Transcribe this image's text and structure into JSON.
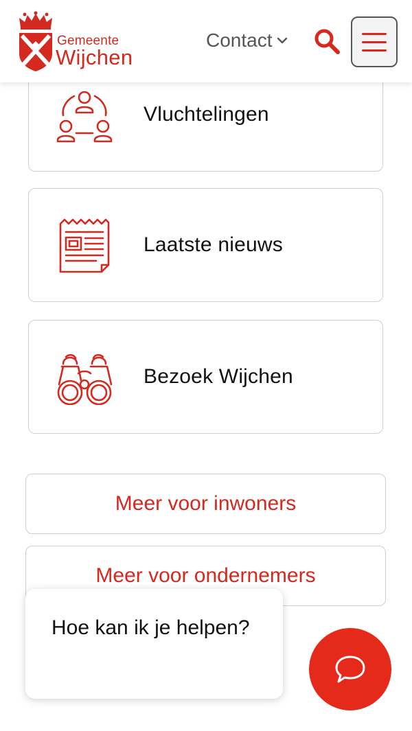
{
  "header": {
    "brand_small": "Gemeente",
    "brand_big": "Wijchen",
    "contact_label": "Contact",
    "brand_color": "#d4291f"
  },
  "cards": [
    {
      "label": "Vluchtelingen",
      "icon": "refugees-icon"
    },
    {
      "label": "Laatste nieuws",
      "icon": "newspaper-icon"
    },
    {
      "label": "Bezoek Wijchen",
      "icon": "binoculars-icon"
    }
  ],
  "more": {
    "inwoners": "Meer voor inwoners",
    "ondernemers": "Meer voor ondernemers"
  },
  "chat": {
    "prompt": "Hoe kan ik je helpen?",
    "fab_color": "#e52a1b"
  }
}
